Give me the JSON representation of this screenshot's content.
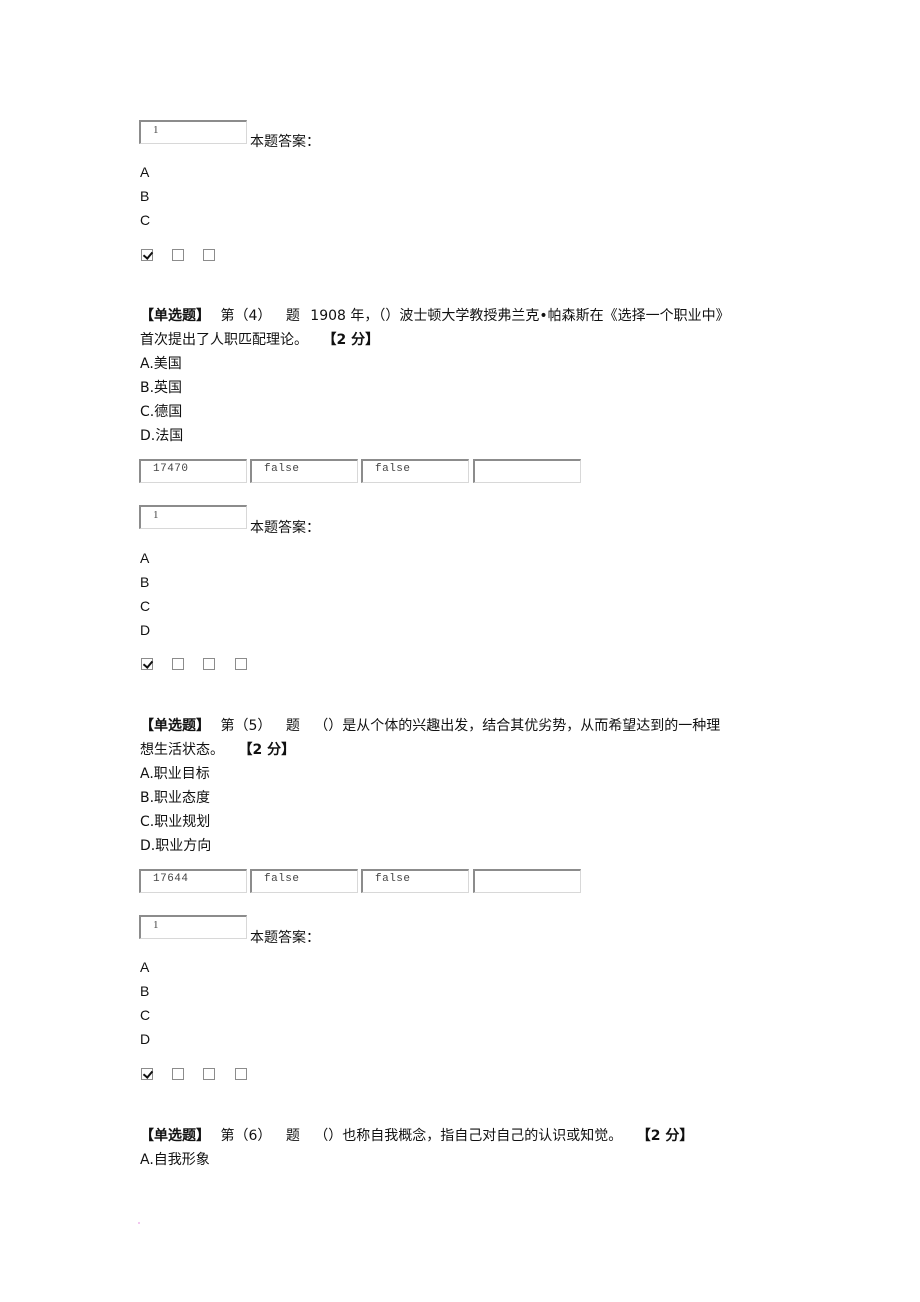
{
  "block_q3": {
    "score_field": "1",
    "answer_label": "本题答案：",
    "answer_letters": [
      "A",
      "B",
      "C"
    ],
    "checkboxes": [
      true,
      false,
      false
    ]
  },
  "q4": {
    "type_tag": "【单选题】",
    "number": "第（4）",
    "ti": "题",
    "stem_line1": "1908 年，（）波士顿大学教授弗兰克•帕森斯在《选择一个职业中》",
    "stem_line2": "首次提出了人职匹配理论。",
    "points": "【2 分】",
    "options": [
      "A.美国",
      "B.英国",
      "C.德国",
      "D.法国"
    ],
    "fields": [
      "17470",
      "false",
      "false",
      ""
    ],
    "score_field": "1",
    "answer_label": "本题答案：",
    "answer_letters": [
      "A",
      "B",
      "C",
      "D"
    ],
    "checkboxes": [
      true,
      false,
      false,
      false
    ]
  },
  "q5": {
    "type_tag": "【单选题】",
    "number": "第（5）",
    "ti": "题",
    "stem_line1": "（）是从个体的兴趣出发，结合其优劣势，从而希望达到的一种理",
    "stem_line2": "想生活状态。",
    "points": "【2 分】",
    "options": [
      "A.职业目标",
      "B.职业态度",
      "C.职业规划",
      "D.职业方向"
    ],
    "fields": [
      "17644",
      "false",
      "false",
      ""
    ],
    "score_field": "1",
    "answer_label": "本题答案：",
    "answer_letters": [
      "A",
      "B",
      "C",
      "D"
    ],
    "checkboxes": [
      true,
      false,
      false,
      false
    ]
  },
  "q6": {
    "type_tag": "【单选题】",
    "number": "第（6）",
    "ti": "题",
    "stem_line1": "（）也称自我概念，指自己对自己的认识或知觉。",
    "points": "【2 分】",
    "options": [
      "A.自我形象"
    ]
  }
}
